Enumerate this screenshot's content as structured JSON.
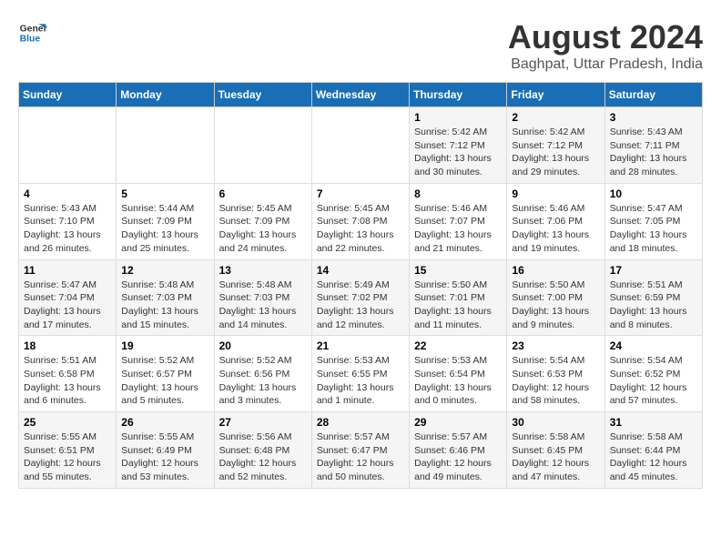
{
  "logo": {
    "line1": "General",
    "line2": "Blue"
  },
  "title": "August 2024",
  "subtitle": "Baghpat, Uttar Pradesh, India",
  "header": {
    "days": [
      "Sunday",
      "Monday",
      "Tuesday",
      "Wednesday",
      "Thursday",
      "Friday",
      "Saturday"
    ]
  },
  "weeks": [
    [
      {
        "day": "",
        "content": ""
      },
      {
        "day": "",
        "content": ""
      },
      {
        "day": "",
        "content": ""
      },
      {
        "day": "",
        "content": ""
      },
      {
        "day": "1",
        "content": "Sunrise: 5:42 AM\nSunset: 7:12 PM\nDaylight: 13 hours\nand 30 minutes."
      },
      {
        "day": "2",
        "content": "Sunrise: 5:42 AM\nSunset: 7:12 PM\nDaylight: 13 hours\nand 29 minutes."
      },
      {
        "day": "3",
        "content": "Sunrise: 5:43 AM\nSunset: 7:11 PM\nDaylight: 13 hours\nand 28 minutes."
      }
    ],
    [
      {
        "day": "4",
        "content": "Sunrise: 5:43 AM\nSunset: 7:10 PM\nDaylight: 13 hours\nand 26 minutes."
      },
      {
        "day": "5",
        "content": "Sunrise: 5:44 AM\nSunset: 7:09 PM\nDaylight: 13 hours\nand 25 minutes."
      },
      {
        "day": "6",
        "content": "Sunrise: 5:45 AM\nSunset: 7:09 PM\nDaylight: 13 hours\nand 24 minutes."
      },
      {
        "day": "7",
        "content": "Sunrise: 5:45 AM\nSunset: 7:08 PM\nDaylight: 13 hours\nand 22 minutes."
      },
      {
        "day": "8",
        "content": "Sunrise: 5:46 AM\nSunset: 7:07 PM\nDaylight: 13 hours\nand 21 minutes."
      },
      {
        "day": "9",
        "content": "Sunrise: 5:46 AM\nSunset: 7:06 PM\nDaylight: 13 hours\nand 19 minutes."
      },
      {
        "day": "10",
        "content": "Sunrise: 5:47 AM\nSunset: 7:05 PM\nDaylight: 13 hours\nand 18 minutes."
      }
    ],
    [
      {
        "day": "11",
        "content": "Sunrise: 5:47 AM\nSunset: 7:04 PM\nDaylight: 13 hours\nand 17 minutes."
      },
      {
        "day": "12",
        "content": "Sunrise: 5:48 AM\nSunset: 7:03 PM\nDaylight: 13 hours\nand 15 minutes."
      },
      {
        "day": "13",
        "content": "Sunrise: 5:48 AM\nSunset: 7:03 PM\nDaylight: 13 hours\nand 14 minutes."
      },
      {
        "day": "14",
        "content": "Sunrise: 5:49 AM\nSunset: 7:02 PM\nDaylight: 13 hours\nand 12 minutes."
      },
      {
        "day": "15",
        "content": "Sunrise: 5:50 AM\nSunset: 7:01 PM\nDaylight: 13 hours\nand 11 minutes."
      },
      {
        "day": "16",
        "content": "Sunrise: 5:50 AM\nSunset: 7:00 PM\nDaylight: 13 hours\nand 9 minutes."
      },
      {
        "day": "17",
        "content": "Sunrise: 5:51 AM\nSunset: 6:59 PM\nDaylight: 13 hours\nand 8 minutes."
      }
    ],
    [
      {
        "day": "18",
        "content": "Sunrise: 5:51 AM\nSunset: 6:58 PM\nDaylight: 13 hours\nand 6 minutes."
      },
      {
        "day": "19",
        "content": "Sunrise: 5:52 AM\nSunset: 6:57 PM\nDaylight: 13 hours\nand 5 minutes."
      },
      {
        "day": "20",
        "content": "Sunrise: 5:52 AM\nSunset: 6:56 PM\nDaylight: 13 hours\nand 3 minutes."
      },
      {
        "day": "21",
        "content": "Sunrise: 5:53 AM\nSunset: 6:55 PM\nDaylight: 13 hours\nand 1 minute."
      },
      {
        "day": "22",
        "content": "Sunrise: 5:53 AM\nSunset: 6:54 PM\nDaylight: 13 hours\nand 0 minutes."
      },
      {
        "day": "23",
        "content": "Sunrise: 5:54 AM\nSunset: 6:53 PM\nDaylight: 12 hours\nand 58 minutes."
      },
      {
        "day": "24",
        "content": "Sunrise: 5:54 AM\nSunset: 6:52 PM\nDaylight: 12 hours\nand 57 minutes."
      }
    ],
    [
      {
        "day": "25",
        "content": "Sunrise: 5:55 AM\nSunset: 6:51 PM\nDaylight: 12 hours\nand 55 minutes."
      },
      {
        "day": "26",
        "content": "Sunrise: 5:55 AM\nSunset: 6:49 PM\nDaylight: 12 hours\nand 53 minutes."
      },
      {
        "day": "27",
        "content": "Sunrise: 5:56 AM\nSunset: 6:48 PM\nDaylight: 12 hours\nand 52 minutes."
      },
      {
        "day": "28",
        "content": "Sunrise: 5:57 AM\nSunset: 6:47 PM\nDaylight: 12 hours\nand 50 minutes."
      },
      {
        "day": "29",
        "content": "Sunrise: 5:57 AM\nSunset: 6:46 PM\nDaylight: 12 hours\nand 49 minutes."
      },
      {
        "day": "30",
        "content": "Sunrise: 5:58 AM\nSunset: 6:45 PM\nDaylight: 12 hours\nand 47 minutes."
      },
      {
        "day": "31",
        "content": "Sunrise: 5:58 AM\nSunset: 6:44 PM\nDaylight: 12 hours\nand 45 minutes."
      }
    ]
  ]
}
